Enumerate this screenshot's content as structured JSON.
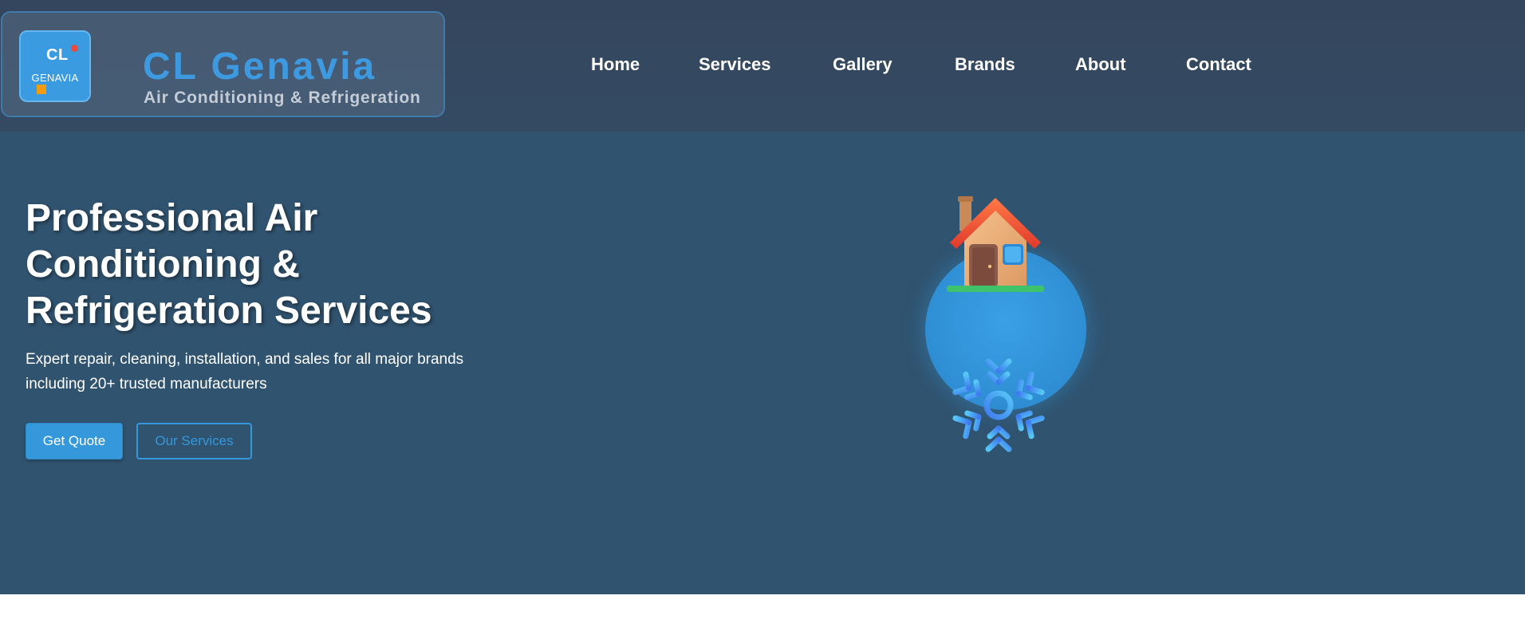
{
  "brand": {
    "logo_initials": "CL",
    "logo_subtext": "GENAVIA",
    "name": "CL Genavia",
    "tagline": "Air Conditioning & Refrigeration"
  },
  "nav": {
    "items": [
      {
        "label": "Home"
      },
      {
        "label": "Services"
      },
      {
        "label": "Gallery"
      },
      {
        "label": "Brands"
      },
      {
        "label": "About"
      },
      {
        "label": "Contact"
      }
    ]
  },
  "hero": {
    "title": "Professional Air Conditioning & Refrigeration Services",
    "subtitle": "Expert repair, cleaning, installation, and sales for all major brands including 20+ trusted manufacturers",
    "primary_button": "Get Quote",
    "secondary_button": "Our Services",
    "illustration_icons": [
      "house-icon",
      "snowflake-icon"
    ]
  },
  "colors": {
    "header_bg": "#34465d",
    "hero_bg": "#30536f",
    "accent": "#3498db",
    "brand_name": "#3d9ae0",
    "logo_dot": "#e74c3c",
    "logo_square": "#f39c12"
  }
}
